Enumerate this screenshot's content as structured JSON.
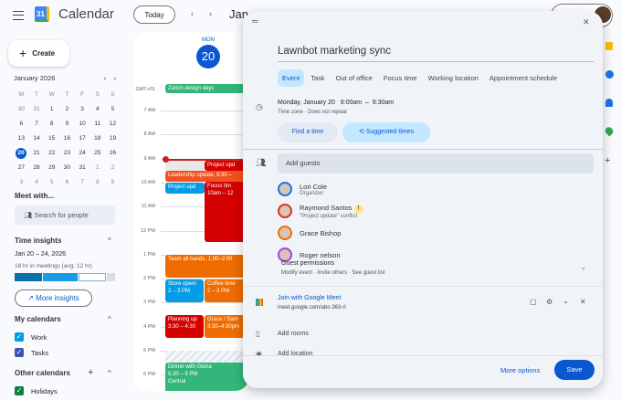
{
  "header": {
    "app_title": "Calendar",
    "logo_text": "31",
    "today_label": "Today",
    "month_partial": "Jan"
  },
  "sidebar": {
    "create_label": "Create",
    "mini_cal": {
      "month": "January 2026",
      "weekdays": [
        "M",
        "T",
        "W",
        "T",
        "F",
        "S",
        "S"
      ],
      "days": [
        [
          "30",
          "31",
          "1",
          "2",
          "3",
          "4",
          "5"
        ],
        [
          "6",
          "7",
          "8",
          "9",
          "10",
          "11",
          "12"
        ],
        [
          "13",
          "14",
          "15",
          "16",
          "17",
          "18",
          "19"
        ],
        [
          "20",
          "21",
          "22",
          "23",
          "24",
          "25",
          "26"
        ],
        [
          "27",
          "28",
          "29",
          "30",
          "31",
          "1",
          "2"
        ],
        [
          "3",
          "4",
          "5",
          "6",
          "7",
          "8",
          "9"
        ]
      ],
      "selected": "20"
    },
    "meet_with": "Meet with...",
    "search_placeholder": "Search for people",
    "time_insights": {
      "title": "Time insights",
      "range": "Jan 20 – 24, 2026",
      "summary": "18 hr in meetings (avg: 12 hr)",
      "more_label": "More insights"
    },
    "my_calendars": {
      "title": "My calendars",
      "items": [
        {
          "label": "Work",
          "color": "#039be5"
        },
        {
          "label": "Tasks",
          "color": "#3f51b5"
        }
      ]
    },
    "other_calendars": {
      "title": "Other calendars",
      "items": [
        {
          "label": "Holidays",
          "color": "#0b8043"
        }
      ]
    }
  },
  "day": {
    "weekday": "MON",
    "date": "20",
    "tz": "GMT+01",
    "hours": [
      "7 AM",
      "8 AM",
      "9 AM",
      "10 AM",
      "11 AM",
      "12 PM",
      "1 PM",
      "2 PM",
      "3 PM",
      "4 PM",
      "5 PM",
      "6 PM"
    ],
    "events": {
      "zurich": "Zürich design days",
      "project1": "Project upd",
      "leadership": "Leadership update, 9:30 –",
      "project2": "Project upd",
      "focus": "Focus tim",
      "focus_time": "10am – 12",
      "allhands": "Team all hands, 1:00–2:00",
      "store": "Store openi",
      "store_time": "2 – 3 PM",
      "coffee": "Coffee time",
      "coffee_time": "2 – 3 PM",
      "planning": "Planning up",
      "planning_time": "3:30 – 4:30",
      "grace": "Grace / Sam",
      "grace_time": "3:30–4:30pm",
      "dinner": "Dinner with Gloria",
      "dinner_time": "5:30 – 9 PM",
      "dinner_loc": "Central"
    },
    "colors": {
      "green": "#33b679",
      "red": "#d50000",
      "orange": "#f4511e",
      "blue": "#039be5"
    }
  },
  "dialog": {
    "title": "Lawnbot marketing sync",
    "tabs": [
      "Event",
      "Task",
      "Out of office",
      "Focus time",
      "Working location",
      "Appointment schedule"
    ],
    "datetime": "Monday, January 20   9:00am  –  9:30am",
    "recurrence": "Time zone · Does not repeat",
    "find_time": "Find a time",
    "suggested": "Suggested times",
    "guests_placeholder": "Add guests",
    "guests": [
      {
        "name": "Lori Cole",
        "sub": "Organizer",
        "ring": "#1a73e8"
      },
      {
        "name": "Raymond Santos",
        "sub": "\"Project update\" conflict",
        "ring": "#d93025",
        "warn": "!"
      },
      {
        "name": "Grace Bishop",
        "sub": "",
        "ring": "#e8710a"
      },
      {
        "name": "Roger nelson",
        "sub": "",
        "ring": "#a142f4"
      }
    ],
    "permissions_title": "Guest permissions",
    "permissions_sub": "Modify event · Invite others · See guest list",
    "meet_label": "Join with Google Meet",
    "meet_link": "meet.google.com/abc-363-rl",
    "add_rooms": "Add rooms",
    "add_location": "Add location",
    "more_options": "More options",
    "save": "Save"
  }
}
